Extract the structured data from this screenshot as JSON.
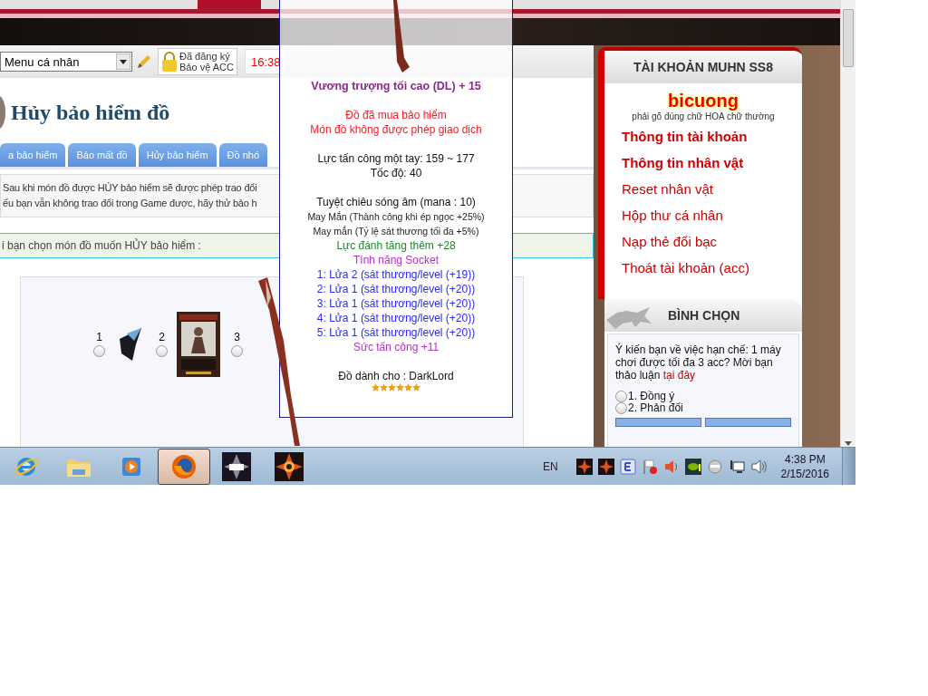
{
  "toolbar": {
    "menu_select": {
      "value": "Menu cá nhân"
    },
    "protection_badge": {
      "lines": [
        "Đã đăng ký",
        "Bảo vệ ACC"
      ]
    },
    "clock": "16:38"
  },
  "page_title": "Hủy bảo hiểm đồ",
  "tabs": [
    {
      "label": "a bảo hiểm",
      "selected": false
    },
    {
      "label": "Báo mất đồ",
      "selected": false
    },
    {
      "label": "Hủy bảo hiểm",
      "selected": false
    },
    {
      "label": "Đồ nhó",
      "selected": false
    }
  ],
  "notice": [
    "Sau khi món đồ được HỦY bảo hiểm sẽ được phép trao đổi",
    "ếu bạn vẫn không trao đổi trong Game được, hãy thử bảo h"
  ],
  "prompt": "i bạn chọn món đồ muốn HỦY bảo hiểm :",
  "items": [
    {
      "number": "1",
      "kind": "wing",
      "selected": false
    },
    {
      "number": "2",
      "kind": "card",
      "selected": false
    },
    {
      "number": "3",
      "kind": "staff",
      "selected": false
    }
  ],
  "tooltip": {
    "title": "Vương trượng tối cao (DL) + 15",
    "lines": [
      {
        "kind": "warning",
        "text": "Đồ đã mua bảo hiểm",
        "spaced": true
      },
      {
        "kind": "warning",
        "text": "Món đồ không được phép giao dịch",
        "spaced": false
      },
      {
        "kind": "normal",
        "text": "Lực tấn công một tay: 159 ~ 177",
        "spaced": true
      },
      {
        "kind": "normal",
        "text": "Tốc độ: 40",
        "spaced": false
      },
      {
        "kind": "normal",
        "text": "Tuyệt chiêu sóng âm (mana : 10)",
        "spaced": true
      },
      {
        "kind": "small",
        "text": "May Mắn (Thành công khi ép ngọc +25%)",
        "spaced": false
      },
      {
        "kind": "small",
        "text": "May mắn (Tỷ lệ sát thương tối đa +5%)",
        "spaced": false
      },
      {
        "kind": "bonus",
        "text": "Lực đánh tăng thêm +28",
        "spaced": false
      },
      {
        "kind": "socket_header",
        "text": "Tính năng Socket",
        "spaced": false
      },
      {
        "kind": "socket",
        "text": "1: Lửa 2 (sát thương/level (+19))",
        "spaced": false
      },
      {
        "kind": "socket",
        "text": "2: Lửa 1 (sát thương/level (+20))",
        "spaced": false
      },
      {
        "kind": "socket",
        "text": "3: Lửa 1 (sát thương/level (+20))",
        "spaced": false
      },
      {
        "kind": "socket",
        "text": "4: Lửa 1 (sát thương/level (+20))",
        "spaced": false
      },
      {
        "kind": "socket",
        "text": "5: Lửa 1 (sát thương/level (+20))",
        "spaced": false
      },
      {
        "kind": "socket_header",
        "text": "Sức tấn công +11",
        "spaced": false
      },
      {
        "kind": "normal",
        "text": "Đồ dành cho : DarkLord",
        "spaced": true
      }
    ],
    "stars": 6
  },
  "sidebar": {
    "account": {
      "title": "TÀI KHOẢN MUHN SS8",
      "username": "bicuong",
      "hint": "phải gõ đúng chữ HOA chữ thường",
      "links": [
        {
          "label": "Thông tin tài khoản",
          "bold": true
        },
        {
          "label": "Thông tin nhân vật",
          "bold": true
        },
        {
          "label": "Reset nhân vật",
          "bold": false
        },
        {
          "label": "Hộp thư cá nhân",
          "bold": false
        },
        {
          "label": "Nạp thẻ đổi bạc",
          "bold": false
        },
        {
          "label": "Thoát tài khoản (acc)",
          "bold": false
        }
      ]
    },
    "poll": {
      "title": "BÌNH CHỌN",
      "question": "Ý kiến bạn về việc hạn chế: 1 máy chơi được tối đa 3 acc? Mời bạn thảo luận",
      "link": "tại đây",
      "options": [
        {
          "label": "1. Đồng ý",
          "selected": false
        },
        {
          "label": "2. Phản đối",
          "selected": false
        }
      ]
    }
  },
  "taskbar": {
    "apps": [
      {
        "kind": "ie",
        "active": false
      },
      {
        "kind": "folder",
        "active": false
      },
      {
        "kind": "media",
        "active": false
      },
      {
        "kind": "firefox",
        "active": true
      },
      {
        "kind": "mu",
        "active": false
      },
      {
        "kind": "game",
        "active": false
      }
    ],
    "language": "EN",
    "tray": [
      {
        "kind": "game"
      },
      {
        "kind": "game"
      },
      {
        "kind": "e"
      },
      {
        "kind": "flag"
      },
      {
        "kind": "speaker_red"
      },
      {
        "kind": "gpu"
      },
      {
        "kind": "face"
      },
      {
        "kind": "network"
      },
      {
        "kind": "volume"
      }
    ],
    "time": "4:38 PM",
    "date": "2/15/2016"
  }
}
